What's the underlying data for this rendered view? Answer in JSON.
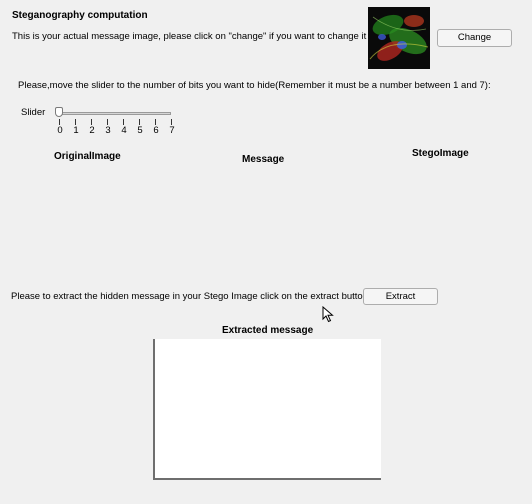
{
  "header": {
    "title": "Steganography computation",
    "intro": "This is your actual message image, please click on \"change\" if you want to change it :",
    "change_label": "Change"
  },
  "slider": {
    "instruction": "Please,move the slider to the number of bits you want to hide(Remember it must be a number between 1 and 7):",
    "label": "Slider",
    "value": 0,
    "min": 0,
    "max": 7,
    "ticks": [
      "0",
      "1",
      "2",
      "3",
      "4",
      "5",
      "6",
      "7"
    ]
  },
  "images": {
    "original_label": "OriginalImage",
    "message_label": "Message",
    "stego_label": "StegoImage"
  },
  "extract": {
    "instruction": "Please to extract the hidden message in your Stego Image click on the extract button:",
    "button_label": "Extract",
    "result_title": "Extracted message"
  },
  "icons": {
    "message_thumbnail": "fluorescent-cell-image",
    "cursor": "mouse-pointer-icon"
  }
}
